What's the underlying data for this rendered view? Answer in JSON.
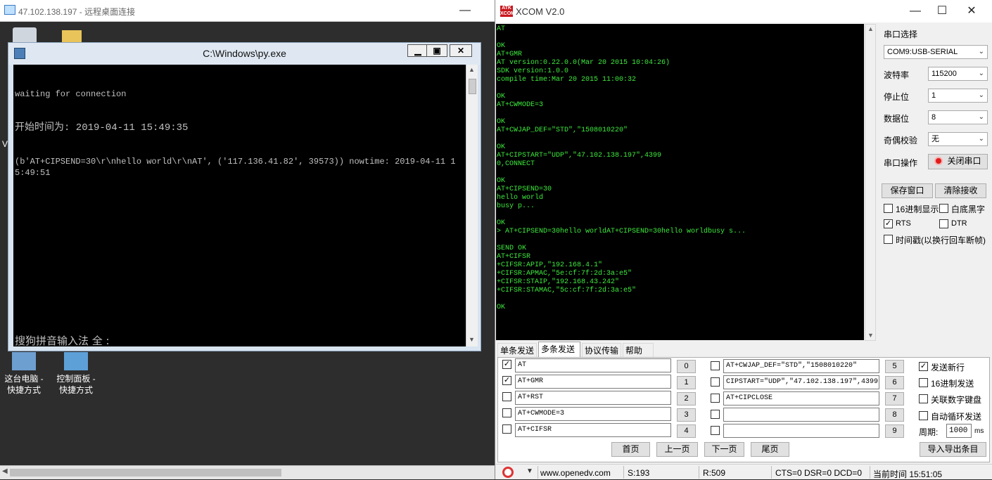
{
  "rdp": {
    "title": "47.102.138.197 - 远程桌面连接",
    "desktop_icons": [
      {
        "label_line1": "这台电脑 -",
        "label_line2": "快捷方式"
      },
      {
        "label_line1": "控制面板 -",
        "label_line2": "快捷方式"
      }
    ],
    "side_letter": "V"
  },
  "console": {
    "title": "C:\\Windows\\py.exe",
    "lines": [
      "waiting for connection",
      "开始时间为: 2019-04-11 15:49:35",
      "(b'AT+CIPSEND=30\\r\\nhello world\\r\\nAT', ('117.136.41.82', 39573)) nowtime: 2019-04-11 15:49:51"
    ],
    "ime_status": "搜狗拼音输入法 全 :"
  },
  "xcom": {
    "title": "XCOM V2.0",
    "logo_text": "ATK XCOM",
    "recv_text": "AT\n\nOK\nAT+GMR\nAT version:0.22.0.0(Mar 20 2015 10:04:26)\nSDK version:1.0.0\ncompile time:Mar 20 2015 11:00:32\n\nOK\nAT+CWMODE=3\n\nOK\nAT+CWJAP_DEF=\"STD\",\"1508010220\"\n\nOK\nAT+CIPSTART=\"UDP\",\"47.102.138.197\",4399\n0,CONNECT\n\nOK\nAT+CIPSEND=30\nhello world\nbusy p...\n\nOK\n> AT+CIPSEND=30hello worldAT+CIPSEND=30hello worldbusy s...\n\nSEND OK\nAT+CIFSR\n+CIFSR:APIP,\"192.168.4.1\"\n+CIFSR:APMAC,\"5e:cf:7f:2d:3a:e5\"\n+CIFSR:STAIP,\"192.168.43.242\"\n+CIFSR:STAMAC,\"5c:cf:7f:2d:3a:e5\"\n\nOK",
    "settings": {
      "port_label": "串口选择",
      "port_value": "COM9:USB-SERIAL",
      "baud_label": "波特率",
      "baud_value": "115200",
      "stop_label": "停止位",
      "stop_value": "1",
      "data_label": "数据位",
      "data_value": "8",
      "parity_label": "奇偶校验",
      "parity_value": "无",
      "op_label": "串口操作",
      "close_port": "关闭串口",
      "save_window": "保存窗口",
      "clear_recv": "清除接收",
      "hex_display": "16进制显示",
      "white_black": "白底黑字",
      "rts": "RTS",
      "dtr": "DTR",
      "timestamp": "时间戳(以换行回车断帧)"
    },
    "tabs": [
      "单条发送",
      "多条发送",
      "协议传输",
      "帮助"
    ],
    "send_rows_left": [
      {
        "checked": true,
        "text": "AT",
        "btn": "0"
      },
      {
        "checked": true,
        "text": "AT+GMR",
        "btn": "1"
      },
      {
        "checked": false,
        "text": "AT+RST",
        "btn": "2"
      },
      {
        "checked": false,
        "text": "AT+CWMODE=3",
        "btn": "3"
      },
      {
        "checked": false,
        "text": "AT+CIFSR",
        "btn": "4"
      }
    ],
    "send_rows_right": [
      {
        "checked": false,
        "text": "AT+CWJAP_DEF=\"STD\",\"1508010220\"",
        "btn": "5"
      },
      {
        "checked": false,
        "text": "CIPSTART=\"UDP\",\"47.102.138.197\",4399",
        "btn": "6"
      },
      {
        "checked": false,
        "text": "AT+CIPCLOSE",
        "btn": "7"
      },
      {
        "checked": false,
        "text": "",
        "btn": "8"
      },
      {
        "checked": false,
        "text": "",
        "btn": "9"
      }
    ],
    "options": {
      "send_newline": "发送新行",
      "hex_send": "16进制发送",
      "link_keyboard": "关联数字键盘",
      "auto_loop": "自动循环发送",
      "period_label": "周期:",
      "period_value": "1000",
      "period_unit": "ms",
      "import_export": "导入导出条目"
    },
    "pager": [
      "首页",
      "上一页",
      "下一页",
      "尾页"
    ],
    "status": {
      "site": "www.openedv.com",
      "sent": "S:193",
      "received": "R:509",
      "lines": "CTS=0 DSR=0 DCD=0",
      "time": "当前时间 15:51:05"
    }
  }
}
